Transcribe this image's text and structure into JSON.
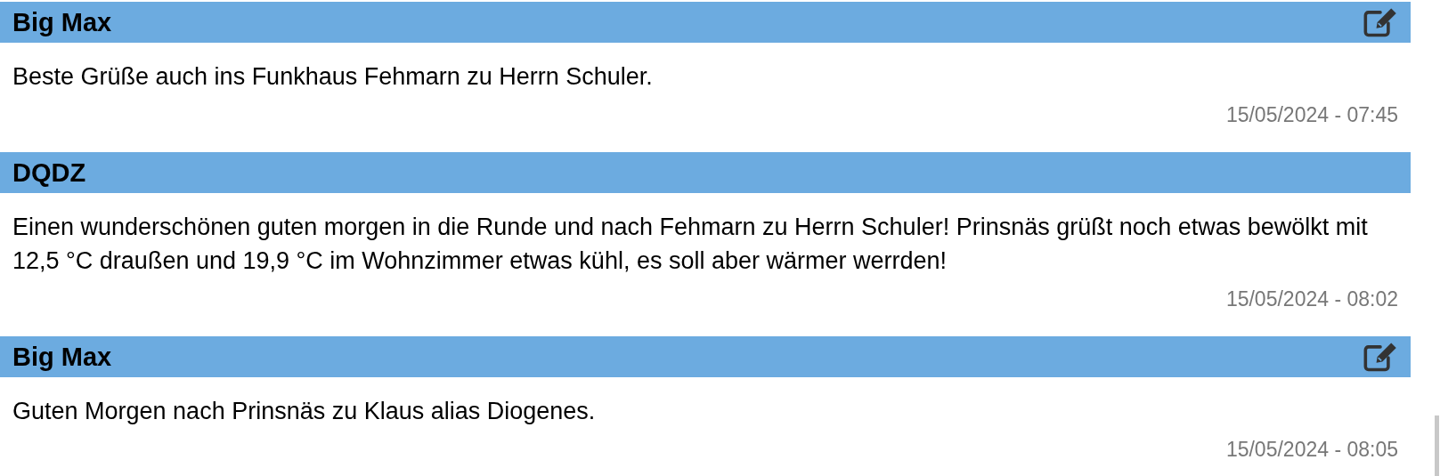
{
  "messages": [
    {
      "author": "Big Max",
      "editable": true,
      "text": "Beste Grüße auch ins Funkhaus Fehmarn zu Herrn Schuler.",
      "time": "15/05/2024 - 07:45"
    },
    {
      "author": "DQDZ",
      "editable": false,
      "text": "Einen wunderschönen guten morgen in die Runde und nach Fehmarn zu Herrn Schuler! Prinsnäs grüßt noch etwas bewölkt mit 12,5 °C draußen und 19,9 °C im Wohnzimmer etwas kühl, es soll aber wärmer werrden!",
      "time": "15/05/2024 - 08:02"
    },
    {
      "author": "Big Max",
      "editable": true,
      "text": "Guten Morgen nach Prinsnäs zu Klaus alias Diogenes.",
      "time": "15/05/2024 - 08:05"
    }
  ]
}
